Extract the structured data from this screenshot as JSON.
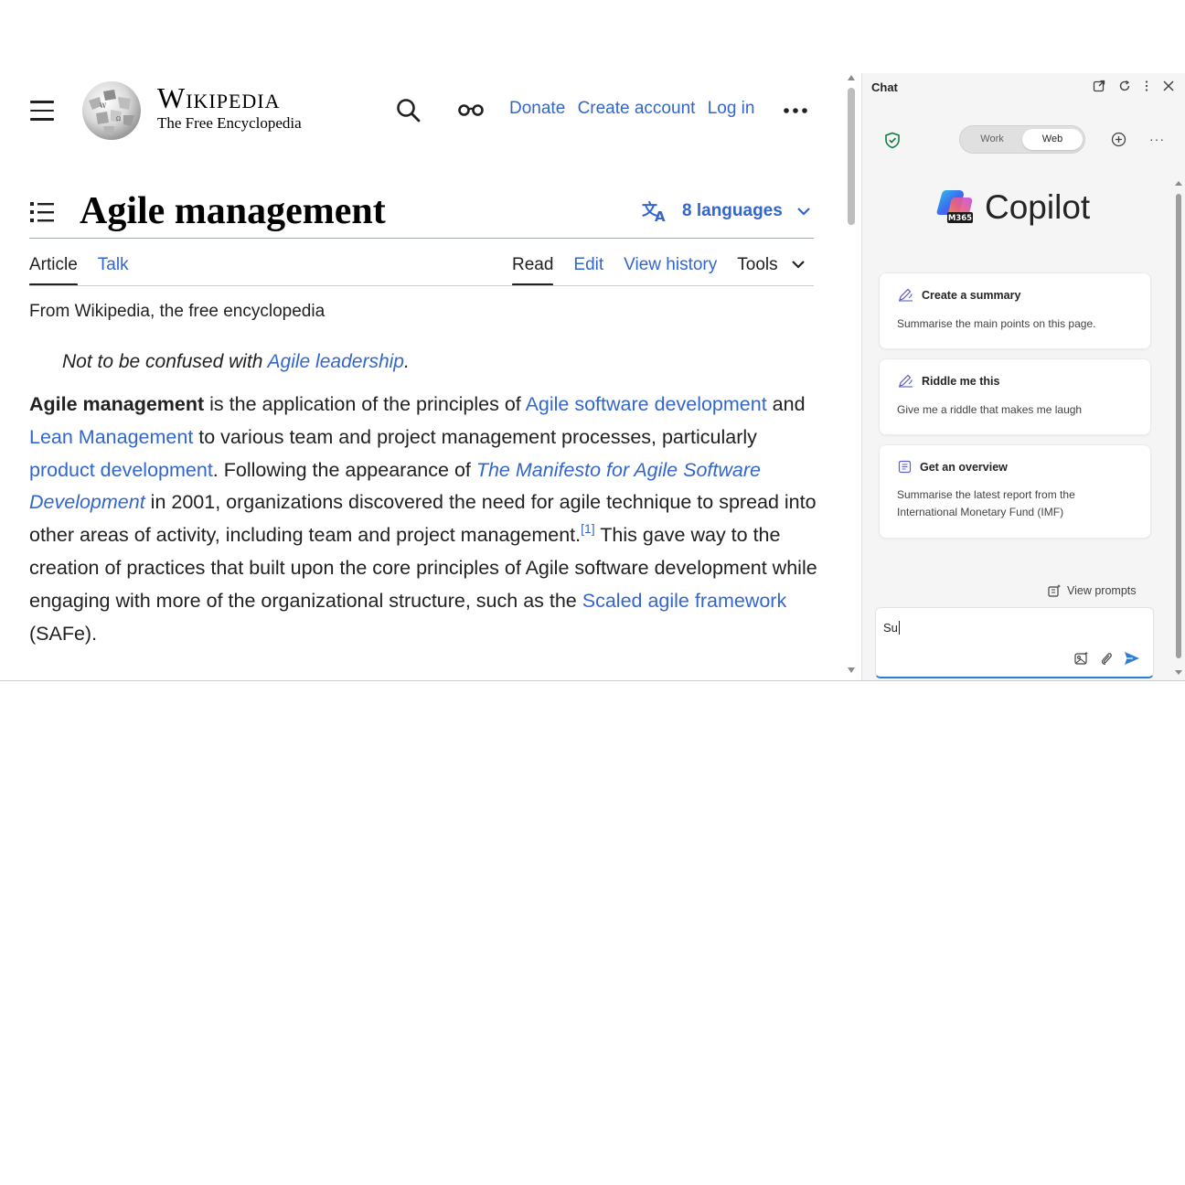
{
  "wiki": {
    "wordmark_title": "Wikipedia",
    "wordmark_tagline": "The Free Encyclopedia",
    "top_links": [
      "Donate",
      "Create account",
      "Log in"
    ],
    "page_title": "Agile management",
    "languages_label": "8 languages",
    "tabs_left": [
      {
        "label": "Article",
        "active": true
      },
      {
        "label": "Talk",
        "active": false
      }
    ],
    "tabs_right": [
      {
        "label": "Read",
        "active": true
      },
      {
        "label": "Edit",
        "active": false
      },
      {
        "label": "View history",
        "active": false
      },
      {
        "label": "Tools",
        "active": false
      }
    ],
    "tagline": "From Wikipedia, the free encyclopedia",
    "hatnote_prefix": "Not to be confused with ",
    "hatnote_link": "Agile leadership",
    "hatnote_suffix": ".",
    "paragraph": {
      "bold_term": "Agile management",
      "t1": " is the application of the principles of ",
      "link1": "Agile software development",
      "t2": " and ",
      "link2": "Lean Management",
      "t3": " to various team and project management processes, particularly ",
      "link3": "product development",
      "t4": ". Following the appearance of ",
      "link4": "The Manifesto for Agile Software Development",
      "t5": " in 2001, organizations discovered the need for agile technique to spread into other areas of activity, including team and project management.",
      "ref": "[1]",
      "t6": " This gave way to the creation of practices that built upon the core principles of Agile software development while engaging with more of the organizational structure, such as the ",
      "link5": "Scaled agile framework",
      "t7": " (SAFe)."
    },
    "link_color": "#3366cc"
  },
  "copilot": {
    "panel_title": "Chat",
    "mode_work": "Work",
    "mode_web": "Web",
    "selected_mode": "Web",
    "logo_badge": "M365",
    "logo_text": "Copilot",
    "cards": [
      {
        "title": "Create a summary",
        "body": "Summarise the main points on this page.",
        "icon": "pen-sparkle-icon"
      },
      {
        "title": "Riddle me this",
        "body": "Give me a riddle that makes me laugh",
        "icon": "pen-sparkle-icon"
      },
      {
        "title": "Get an overview",
        "body_line1": "Summarise the latest report from the",
        "body_line2": "International Monetary Fund (IMF)",
        "icon": "document-list-icon"
      }
    ],
    "view_prompts": "View prompts",
    "input_value": "Su",
    "accent_color": "#2d7dd2"
  }
}
